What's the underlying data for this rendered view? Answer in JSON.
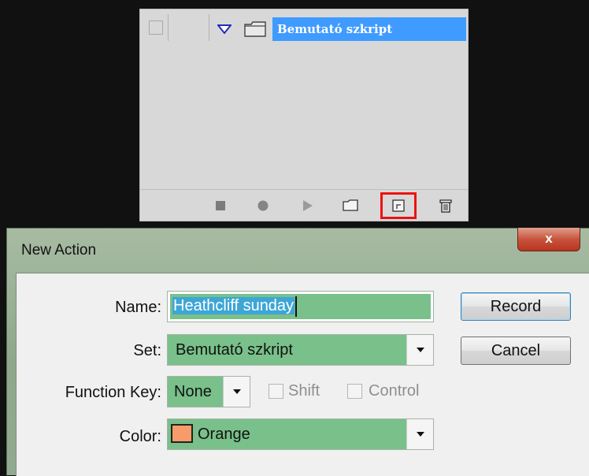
{
  "actions_panel": {
    "set_name": "Bemutató szkript",
    "footer_icons": [
      "stop-icon",
      "record-icon",
      "play-icon",
      "folder-icon",
      "new-action-icon",
      "trash-icon"
    ]
  },
  "dialog": {
    "title": "New Action",
    "close_label": "x",
    "name_label": "Name:",
    "name_value": "Heathcliff sunday",
    "set_label": "Set:",
    "set_value": "Bemutató szkript",
    "function_key_label": "Function Key:",
    "function_key_value": "None",
    "shift_label": "Shift",
    "control_label": "Control",
    "color_label": "Color:",
    "color_value": "Orange",
    "record_label": "Record",
    "cancel_label": "Cancel"
  },
  "colors": {
    "highlight_border": "#ee1111",
    "set_selection": "#3f9bff",
    "field_fill": "#79c08a",
    "orange_swatch": "#f79b6b"
  }
}
